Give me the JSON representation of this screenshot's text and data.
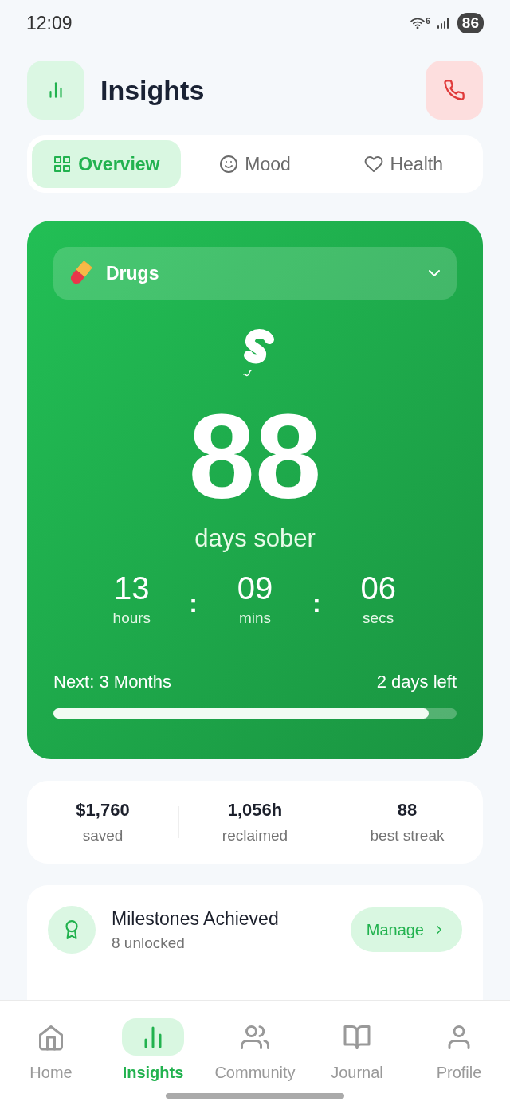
{
  "status_bar": {
    "time": "12:09",
    "wifi_label": "6",
    "battery": "86"
  },
  "header": {
    "title": "Insights"
  },
  "tabs": [
    {
      "label": "Overview",
      "selected": true
    },
    {
      "label": "Mood",
      "selected": false
    },
    {
      "label": "Health",
      "selected": false
    }
  ],
  "counter": {
    "category": "Drugs",
    "days": "88",
    "days_label": "days sober",
    "time": [
      {
        "value": "13",
        "unit": "hours"
      },
      {
        "value": "09",
        "unit": "mins"
      },
      {
        "value": "06",
        "unit": "secs"
      }
    ],
    "separator": ":",
    "next_label": "Next: 3 Months",
    "remaining": "2 days left",
    "level": 0.93
  },
  "stats": [
    {
      "value": "$1,760",
      "label": "saved"
    },
    {
      "value": "1,056h",
      "label": "reclaimed"
    },
    {
      "value": "88",
      "label": "best streak"
    }
  ],
  "milestones": {
    "title": "Milestones Achieved",
    "subtitle": "8 unlocked",
    "button": "Manage"
  },
  "nav": [
    {
      "label": "Home",
      "selected": false
    },
    {
      "label": "Insights",
      "selected": true
    },
    {
      "label": "Community",
      "selected": false
    },
    {
      "label": "Journal",
      "selected": false
    },
    {
      "label": "Profile",
      "selected": false
    }
  ]
}
